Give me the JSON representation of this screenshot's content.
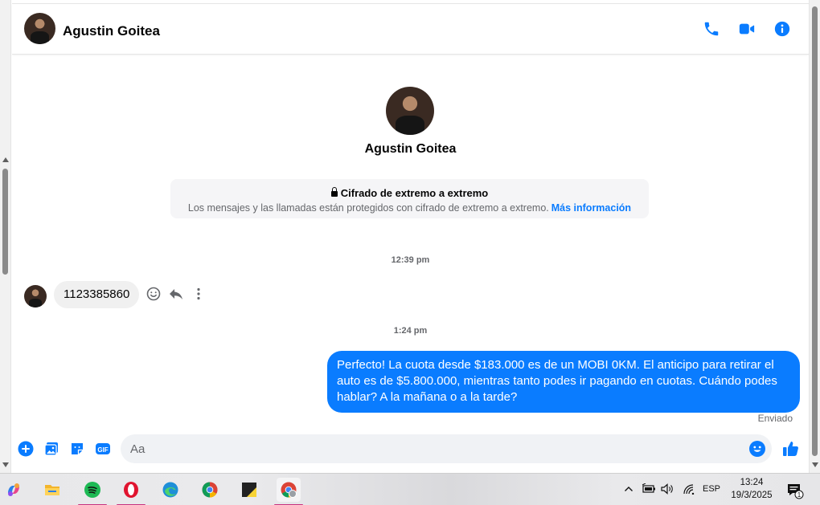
{
  "header": {
    "contact_name": "Agustin Goitea",
    "icons": [
      "phone-icon",
      "video-call-icon",
      "info-icon"
    ],
    "accent_color": "#0a7cff"
  },
  "profile": {
    "name": "Agustin Goitea"
  },
  "encryption": {
    "title": "Cifrado de extremo a extremo",
    "body": "Los mensajes y las llamadas están protegidos con cifrado de extremo a extremo.",
    "link": "Más información"
  },
  "thread": {
    "timestamp_1": "12:39 pm",
    "incoming_message": "1123385860",
    "timestamp_2": "1:24 pm",
    "outgoing_message": "Perfecto! La cuota desde $183.000 es de un MOBI 0KM. El anticipo para retirar el auto es de $5.800.000, mientras tanto podes ir pagando en cuotas. Cuándo podes hablar? A la mañana o a la tarde?",
    "outgoing_status": "Enviado"
  },
  "composer": {
    "placeholder": "Aa",
    "icons": [
      "add-icon",
      "photo-icon",
      "sticker-icon",
      "gif-icon",
      "emoji-icon",
      "like-icon"
    ]
  },
  "taskbar": {
    "apps": [
      "copilot",
      "file-explorer",
      "spotify",
      "opera",
      "edge",
      "chrome",
      "sticky-notes",
      "chrome-profile"
    ],
    "language": "ESP",
    "time": "13:24",
    "date": "19/3/2025",
    "notification_count": "1"
  }
}
